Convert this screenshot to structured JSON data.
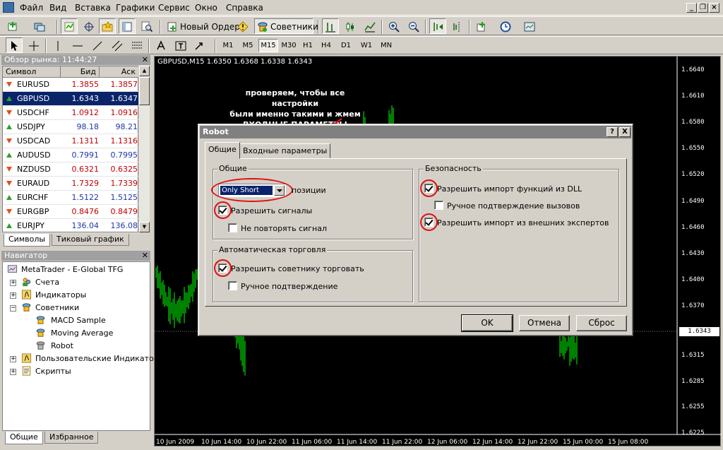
{
  "menu": {
    "items": [
      "Файл",
      "Вид",
      "Вставка",
      "Графики",
      "Сервис",
      "Окно",
      "Справка"
    ]
  },
  "toolbar": {
    "new_order_label": "Новый Ордер",
    "experts_label": "Советники",
    "timeframes": [
      "M1",
      "M5",
      "M15",
      "M30",
      "H1",
      "H4",
      "D1",
      "W1",
      "MN"
    ],
    "active_timeframe": "M15"
  },
  "market_watch": {
    "title": "Обзор рынка: 11:44:27",
    "columns": [
      "Символ",
      "Бид",
      "Аск"
    ],
    "rows": [
      {
        "symbol": "EURUSD",
        "bid": "1.3855",
        "ask": "1.3857",
        "dir": "down",
        "color": "red"
      },
      {
        "symbol": "GBPUSD",
        "bid": "1.6343",
        "ask": "1.6347",
        "dir": "up",
        "color": "blue",
        "selected": true
      },
      {
        "symbol": "USDCHF",
        "bid": "1.0912",
        "ask": "1.0916",
        "dir": "down",
        "color": "red"
      },
      {
        "symbol": "USDJPY",
        "bid": "98.18",
        "ask": "98.21",
        "dir": "up",
        "color": "blue"
      },
      {
        "symbol": "USDCAD",
        "bid": "1.1311",
        "ask": "1.1316",
        "dir": "down",
        "color": "red"
      },
      {
        "symbol": "AUDUSD",
        "bid": "0.7991",
        "ask": "0.7995",
        "dir": "up",
        "color": "blue"
      },
      {
        "symbol": "NZDUSD",
        "bid": "0.6321",
        "ask": "0.6325",
        "dir": "down",
        "color": "red"
      },
      {
        "symbol": "EURAUD",
        "bid": "1.7329",
        "ask": "1.7339",
        "dir": "down",
        "color": "red"
      },
      {
        "symbol": "EURCHF",
        "bid": "1.5122",
        "ask": "1.5125",
        "dir": "up",
        "color": "blue"
      },
      {
        "symbol": "EURGBP",
        "bid": "0.8476",
        "ask": "0.8479",
        "dir": "down",
        "color": "red"
      },
      {
        "symbol": "EURJPY",
        "bid": "136.04",
        "ask": "136.08",
        "dir": "up",
        "color": "blue"
      }
    ],
    "tabs": [
      "Символы",
      "Тиковый график"
    ]
  },
  "navigator": {
    "title": "Навигатор",
    "root": "MetaTrader - E-Global TFG",
    "items": [
      "Счета",
      "Индикаторы",
      "Советники",
      "Пользовательские Индикаторы",
      "Скрипты"
    ],
    "experts": [
      "MACD Sample",
      "Moving Average",
      "Robot"
    ],
    "tabs": [
      "Общие",
      "Избранное"
    ]
  },
  "chart": {
    "title": "GBPUSD,M15  1.6350 1.6368 1.6338 1.6343",
    "y_ticks": [
      "1.6640",
      "1.6610",
      "1.6580",
      "1.6550",
      "1.6520",
      "1.6490",
      "1.6460",
      "1.6430",
      "1.6400",
      "1.6370",
      "1.6343",
      "1.6315",
      "1.6285",
      "1.6255",
      "1.6225"
    ],
    "current_price": "1.6343",
    "x_ticks": [
      "10 Jun 2009",
      "10 Jun 14:00",
      "10 Jun 22:00",
      "11 Jun 06:00",
      "11 Jun 14:00",
      "11 Jun 22:00",
      "12 Jun 06:00",
      "12 Jun 14:00",
      "12 Jun 22:00",
      "15 Jun 00:00",
      "15 Jun 08:00"
    ],
    "bar_color": "#00ff00"
  },
  "annotation": {
    "text_line1": "проверяем, чтобы все настройки",
    "text_line2": "были именно такими и жмем",
    "text_line3": "ВХОДНЫЕ ПАРАМЕТРЫ"
  },
  "dialog": {
    "title": "Robot",
    "help_btn": "?",
    "close_btn": "X",
    "tabs": [
      "Общие",
      "Входные параметры"
    ],
    "group_common": "Общие",
    "position_select": "Only Short",
    "position_label": "позиции",
    "allow_signals": "Разрешить сигналы",
    "no_repeat_signal": "Не повторять сигнал",
    "group_auto": "Автоматическая торговля",
    "allow_expert_trade": "Разрешить советнику торговать",
    "manual_confirm": "Ручное подтверждение",
    "group_security": "Безопасность",
    "allow_dll": "Разрешить импорт функций из DLL",
    "manual_calls": "Ручное подтверждение вызовов",
    "allow_external": "Разрешить импорт из внешних экспертов",
    "ok": "OK",
    "cancel": "Отмена",
    "reset": "Сброс"
  },
  "colors": {
    "highlight": "#e01010",
    "selection": "#0a246a"
  }
}
